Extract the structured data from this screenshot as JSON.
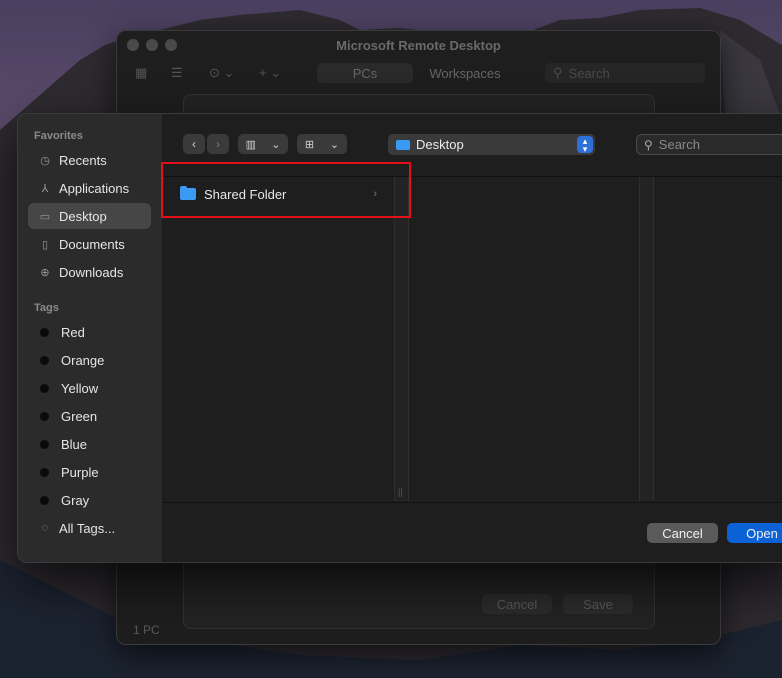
{
  "background_window": {
    "title": "Microsoft Remote Desktop",
    "tabs": [
      "PCs",
      "Workspaces"
    ],
    "search_placeholder": "Search",
    "sheet_buttons": {
      "cancel": "Cancel",
      "save": "Save"
    },
    "footer": "1 PC"
  },
  "dialog": {
    "sidebar": {
      "favorites_header": "Favorites",
      "favorites": [
        {
          "label": "Recents",
          "icon": "clock-icon"
        },
        {
          "label": "Applications",
          "icon": "applications-icon"
        },
        {
          "label": "Desktop",
          "icon": "desktop-icon",
          "selected": true
        },
        {
          "label": "Documents",
          "icon": "document-icon"
        },
        {
          "label": "Downloads",
          "icon": "download-icon"
        }
      ],
      "tags_header": "Tags",
      "tags": [
        "Red",
        "Orange",
        "Yellow",
        "Green",
        "Blue",
        "Purple",
        "Gray",
        "All Tags..."
      ]
    },
    "toolbar": {
      "location": "Desktop",
      "search_placeholder": "Search"
    },
    "files": [
      {
        "name": "Shared Folder",
        "type": "folder"
      }
    ],
    "buttons": {
      "cancel": "Cancel",
      "open": "Open"
    }
  },
  "colors": {
    "accent": "#0a62d6",
    "folder": "#3a9bf5",
    "highlight": "#e3101a"
  }
}
